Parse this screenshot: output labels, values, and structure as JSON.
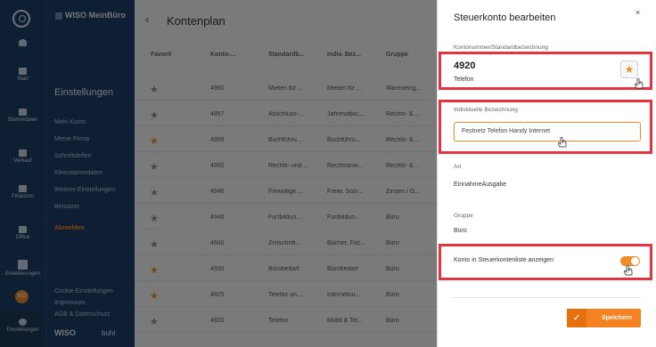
{
  "rail": {
    "items": [
      {
        "label": "Start"
      },
      {
        "label": "Stammdaten"
      },
      {
        "label": "Verkauf"
      },
      {
        "label": "Finanzen"
      },
      {
        "label": "Office"
      },
      {
        "label": "Erweiterungen"
      },
      {
        "label": "Einstellungen"
      }
    ],
    "avatar": "MO"
  },
  "sidebar": {
    "logo": "WISO MeinBüro",
    "title": "Einstellungen",
    "links": [
      "Mein Konto",
      "Meine Firma",
      "Schnittstellen",
      "Kleinstammdaten",
      "Weitere Einstellungen",
      "Benutzer",
      "Abmelden"
    ],
    "footer_links": [
      "Cookie Einstellungen",
      "Impressum",
      "AGB & Datenschutz"
    ],
    "footer_logo": "WISO",
    "footer_brand": "buhl"
  },
  "main": {
    "title": "Kontenplan",
    "columns": [
      "Favorit",
      "Konto-...",
      "Standardb...",
      "Indiv. Bez...",
      "Gruppe"
    ],
    "rows": [
      {
        "fav": false,
        "konto": "4960",
        "std": "Mieten für ...",
        "indiv": "Mieten für ...",
        "gruppe": "Wareneing..."
      },
      {
        "fav": false,
        "konto": "4957",
        "std": "Abschluss-...",
        "indiv": "Jahresabsc...",
        "gruppe": "Rechts- & ..."
      },
      {
        "fav": true,
        "konto": "4955",
        "std": "Buchführu...",
        "indiv": "Buchführu...",
        "gruppe": "Rechts- & ..."
      },
      {
        "fav": false,
        "konto": "4950",
        "std": "Rechts- und ...",
        "indiv": "Rechtsanw...",
        "gruppe": "Rechts- & ..."
      },
      {
        "fav": false,
        "konto": "4946",
        "std": "Freiwillige ...",
        "indiv": "Freiw. Sozi...",
        "gruppe": "Zinsen / G..."
      },
      {
        "fav": false,
        "konto": "4945",
        "std": "Fortbildun...",
        "indiv": "Fortbildun...",
        "gruppe": "Büro"
      },
      {
        "fav": false,
        "konto": "4940",
        "std": "Zeitschrift...",
        "indiv": "Bücher, Fac...",
        "gruppe": "Büro"
      },
      {
        "fav": true,
        "konto": "4930",
        "std": "Bürobedarf",
        "indiv": "Bürobedarf",
        "gruppe": "Büro"
      },
      {
        "fav": true,
        "konto": "4925",
        "std": "Telefax un...",
        "indiv": "Internetnu...",
        "gruppe": "Büro"
      },
      {
        "fav": false,
        "konto": "4920",
        "std": "Telefon",
        "indiv": "Mobil & Tel...",
        "gruppe": "Büro"
      }
    ]
  },
  "panel": {
    "title": "Steuerkonto bearbeiten",
    "close": "×",
    "konto_label": "Kontonummer/Standardbezeichnung",
    "konto_number": "4920",
    "konto_name": "Telefon",
    "indiv_label": "Individuelle Bezeichnung",
    "indiv_value": "Festnetz Telefon Handy Internet",
    "art_label": "Art",
    "art_value": "EinnahmeAusgabe",
    "gruppe_label": "Gruppe",
    "gruppe_value": "Büro",
    "toggle_label": "Konto in Steuerkontenliste anzeigen",
    "toggle_on": true,
    "save_label": "Speichern"
  },
  "colors": {
    "accent": "#f58220",
    "highlight": "#e3343f",
    "sidebar": "#1d3f69"
  }
}
